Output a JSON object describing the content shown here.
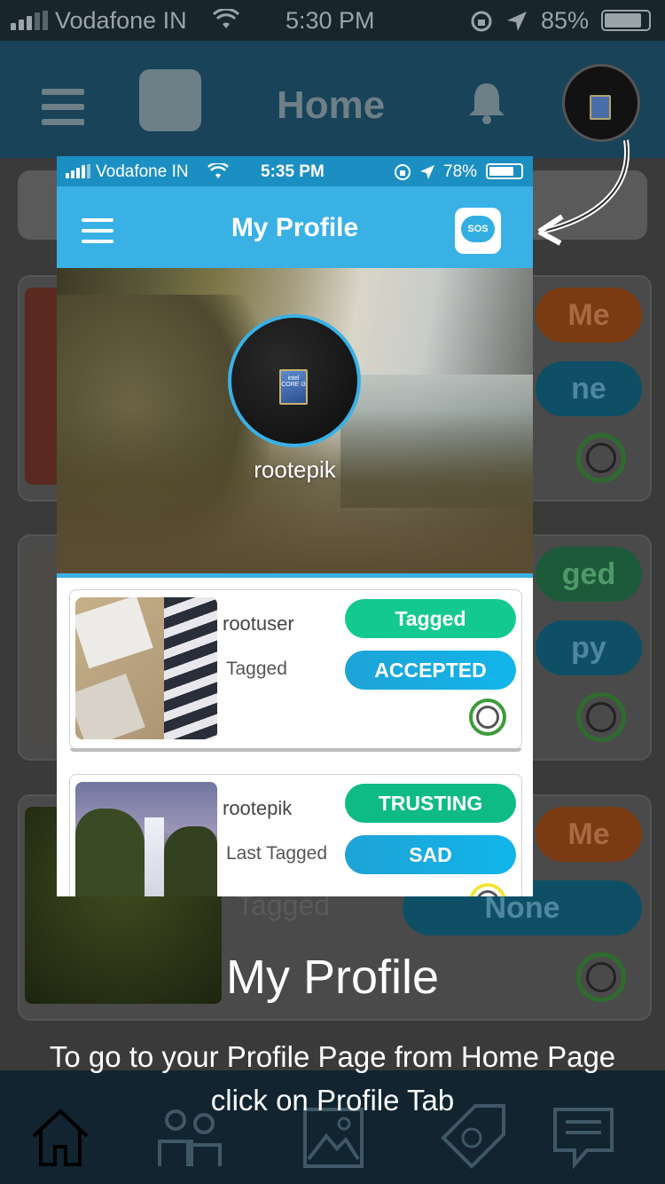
{
  "background_screen": {
    "status_bar": {
      "carrier": "Vodafone IN",
      "time": "5:30 PM",
      "battery": "85%"
    },
    "header": {
      "title": "Home"
    },
    "cards": [
      {
        "pill_top": "Me",
        "pill_bottom": "ne"
      },
      {
        "pill_top": "ged",
        "pill_bottom": "py"
      },
      {
        "sub_label": "Tagged",
        "pill_top": "Me",
        "pill_bottom": "None"
      }
    ],
    "colors": {
      "overlay": "#3a3a3a",
      "header": "#184358",
      "orange": "#7a3a12",
      "teal": "#0f4f66",
      "green": "#1c5a3a"
    }
  },
  "phone_screen": {
    "status_bar": {
      "carrier": "Vodafone IN",
      "time": "5:35 PM",
      "battery": "78%"
    },
    "header": {
      "title": "My Profile",
      "sos_label": "SOS"
    },
    "profile": {
      "username": "rootepik",
      "chip_text": "intel CORE i3"
    },
    "cards": [
      {
        "name": "rootuser",
        "sub": "Tagged",
        "pill_top": "Tagged",
        "pill_bottom": "ACCEPTED",
        "ring": "green"
      },
      {
        "name": "rootepik",
        "sub": "Last Tagged",
        "pill_top": "TRUSTING",
        "pill_bottom": "SAD",
        "ring": "yellow"
      }
    ],
    "colors": {
      "header": "#3ab1e5",
      "status": "#1c8fc2",
      "green_pill": "#14c98f",
      "blue_pill": "#1fa7dc"
    }
  },
  "overlay": {
    "title": "My Profile",
    "description": "To go to your Profile Page from Home Page click on Profile Tab"
  },
  "icons": [
    "hamburger-icon",
    "sos-icon",
    "bell-icon",
    "wifi-icon",
    "location-icon",
    "lock-rotation-icon",
    "home-icon",
    "people-icon",
    "gallery-icon",
    "tag-icon",
    "chat-icon",
    "curved-arrow-icon"
  ]
}
